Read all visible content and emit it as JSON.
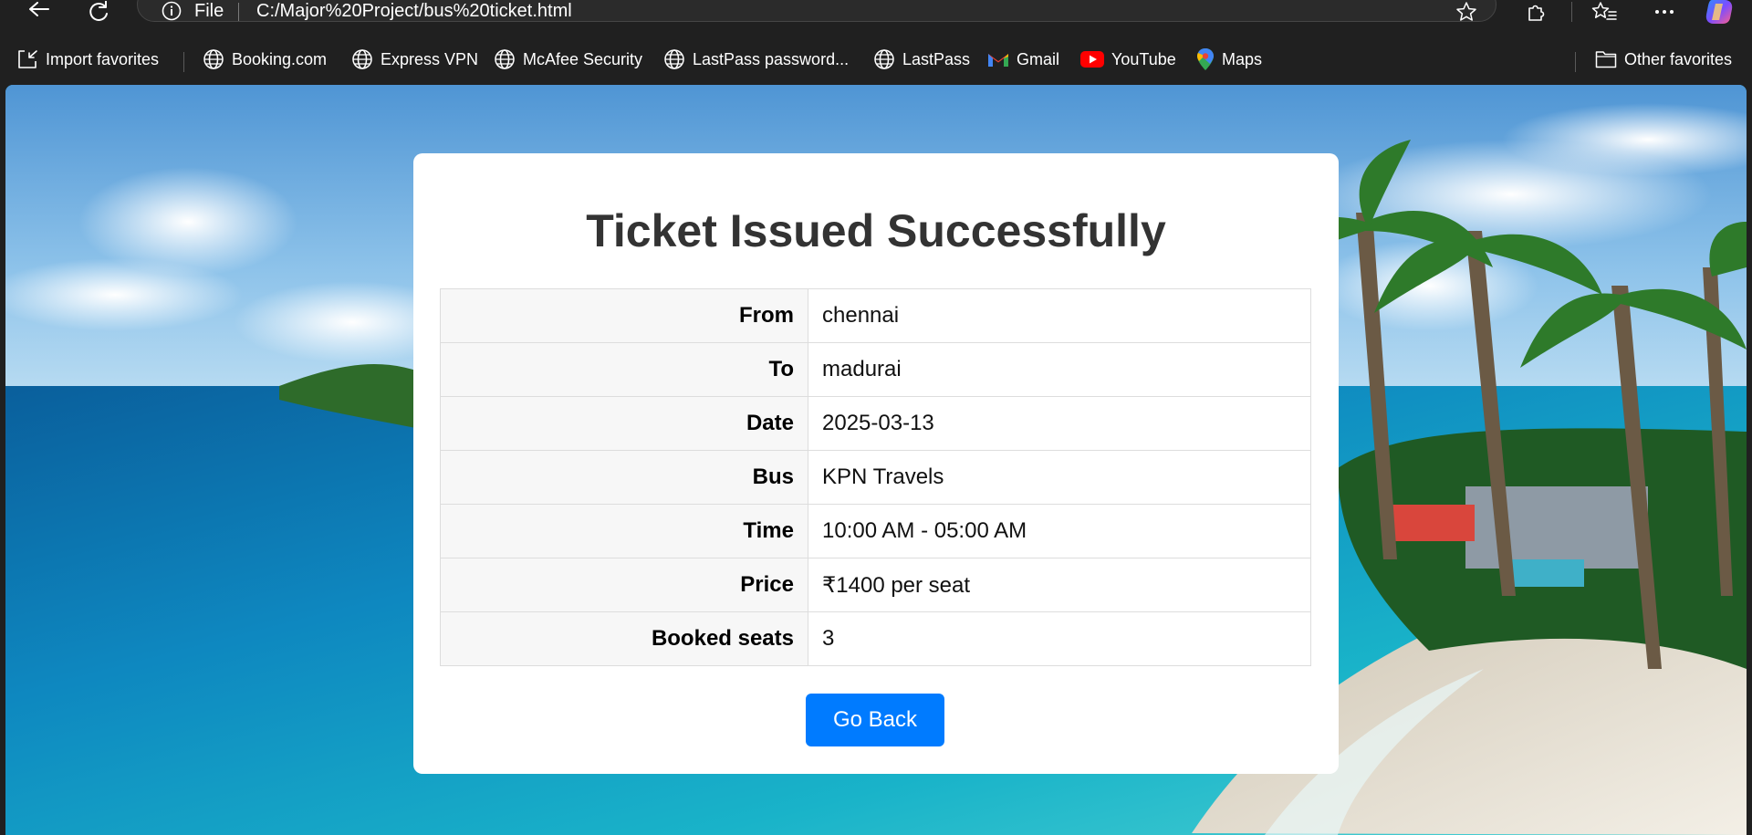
{
  "browser": {
    "address": {
      "scheme_label": "File",
      "url": "C:/Major%20Project/bus%20ticket.html"
    },
    "favorites": [
      {
        "label": "Import favorites",
        "icon": "import-favorites-icon"
      },
      {
        "label": "Booking.com",
        "icon": "globe-icon"
      },
      {
        "label": "Express VPN",
        "icon": "globe-icon"
      },
      {
        "label": "McAfee Security",
        "icon": "globe-icon"
      },
      {
        "label": "LastPass password...",
        "icon": "globe-icon"
      },
      {
        "label": "LastPass",
        "icon": "globe-icon"
      },
      {
        "label": "Gmail",
        "icon": "gmail-icon"
      },
      {
        "label": "YouTube",
        "icon": "youtube-icon"
      },
      {
        "label": "Maps",
        "icon": "maps-icon"
      },
      {
        "label": "Other favorites",
        "icon": "folder-icon"
      }
    ]
  },
  "page": {
    "title": "Ticket Issued Successfully",
    "ticket": [
      {
        "label": "From",
        "value": "chennai"
      },
      {
        "label": "To",
        "value": "madurai"
      },
      {
        "label": "Date",
        "value": "2025-03-13"
      },
      {
        "label": "Bus",
        "value": "KPN Travels"
      },
      {
        "label": "Time",
        "value": "10:00 AM - 05:00 AM"
      },
      {
        "label": "Price",
        "value": "₹1400 per seat"
      },
      {
        "label": "Booked seats",
        "value": "3"
      }
    ],
    "back_button": "Go Back"
  },
  "colors": {
    "button": "#007bff",
    "title": "#333333",
    "chrome": "#202020"
  }
}
